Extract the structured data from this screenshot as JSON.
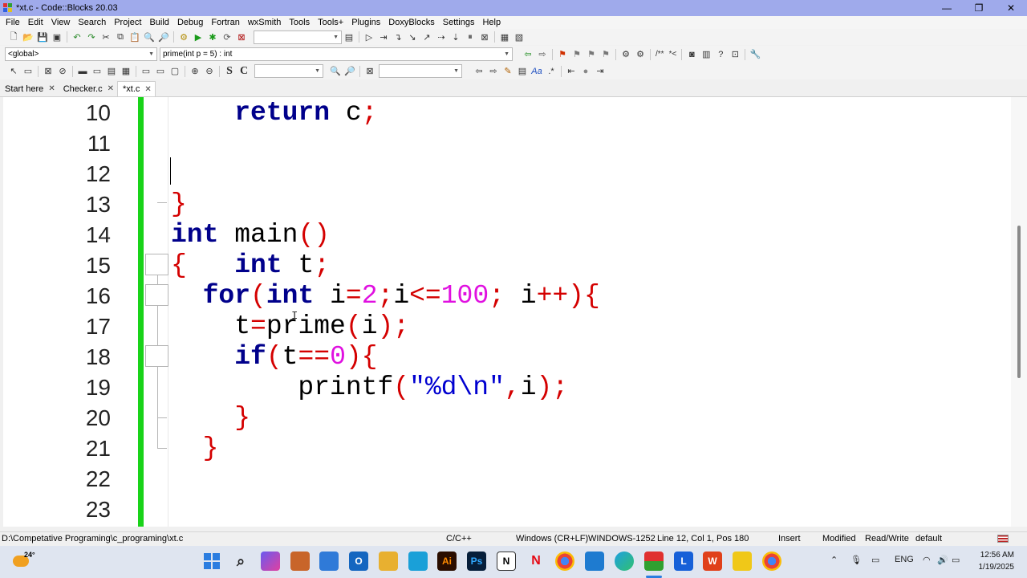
{
  "window": {
    "title": "*xt.c - Code::Blocks 20.03",
    "min": "—",
    "restore": "❐",
    "close": "✕"
  },
  "menu": [
    "File",
    "Edit",
    "View",
    "Search",
    "Project",
    "Build",
    "Debug",
    "Fortran",
    "wxSmith",
    "Tools",
    "Tools+",
    "Plugins",
    "DoxyBlocks",
    "Settings",
    "Help"
  ],
  "toolbar2": {
    "scope": "<global>",
    "symbol": "prime(int p = 5) : int"
  },
  "toolbar3": {
    "s_label": "S",
    "c_label": "C",
    "comment_label": "/**",
    "comment2_label": "*<"
  },
  "tabs": [
    {
      "label": "Start here",
      "active": false
    },
    {
      "label": "Checker.c",
      "active": false
    },
    {
      "label": "*xt.c",
      "active": true
    }
  ],
  "editor": {
    "lines": [
      {
        "num": "10",
        "tokens": [
          [
            "",
            "    "
          ],
          [
            "kw",
            "return"
          ],
          [
            "",
            " c"
          ],
          [
            "pu",
            ";"
          ]
        ]
      },
      {
        "num": "11",
        "tokens": []
      },
      {
        "num": "12",
        "tokens": []
      },
      {
        "num": "13",
        "tokens": [
          [
            "pu",
            "}"
          ]
        ]
      },
      {
        "num": "14",
        "tokens": [
          [
            "kw",
            "int"
          ],
          [
            "",
            " main"
          ],
          [
            "pu",
            "()"
          ]
        ]
      },
      {
        "num": "15",
        "tokens": [
          [
            "pu",
            "{"
          ],
          [
            "",
            "   "
          ],
          [
            "kw",
            "int"
          ],
          [
            "",
            " t"
          ],
          [
            "pu",
            ";"
          ]
        ]
      },
      {
        "num": "16",
        "tokens": [
          [
            "",
            "  "
          ],
          [
            "kw",
            "for"
          ],
          [
            "pu",
            "("
          ],
          [
            "kw",
            "int"
          ],
          [
            "",
            " i"
          ],
          [
            "pu",
            "="
          ],
          [
            "nm",
            "2"
          ],
          [
            "pu",
            ";"
          ],
          [
            "",
            "i"
          ],
          [
            "pu",
            "<="
          ],
          [
            "nm",
            "100"
          ],
          [
            "pu",
            ";"
          ],
          [
            "",
            " i"
          ],
          [
            "pu",
            "++){"
          ]
        ]
      },
      {
        "num": "17",
        "tokens": [
          [
            "",
            "    t"
          ],
          [
            "pu",
            "="
          ],
          [
            "",
            "prime"
          ],
          [
            "pu",
            "("
          ],
          [
            "",
            "i"
          ],
          [
            "pu",
            ");"
          ]
        ]
      },
      {
        "num": "18",
        "tokens": [
          [
            "",
            "    "
          ],
          [
            "kw",
            "if"
          ],
          [
            "pu",
            "("
          ],
          [
            "",
            "t"
          ],
          [
            "pu",
            "=="
          ],
          [
            "nm",
            "0"
          ],
          [
            "pu",
            "){"
          ]
        ]
      },
      {
        "num": "19",
        "tokens": [
          [
            "",
            "        printf"
          ],
          [
            "pu",
            "("
          ],
          [
            "st",
            "\"%d\\n\""
          ],
          [
            "pu",
            ","
          ],
          [
            "",
            "i"
          ],
          [
            "pu",
            ");"
          ]
        ]
      },
      {
        "num": "20",
        "tokens": [
          [
            "",
            "    "
          ],
          [
            "pu",
            "}"
          ]
        ]
      },
      {
        "num": "21",
        "tokens": [
          [
            "",
            "  "
          ],
          [
            "pu",
            "}"
          ]
        ]
      },
      {
        "num": "22",
        "tokens": []
      },
      {
        "num": "23",
        "tokens": []
      }
    ]
  },
  "status": {
    "path": "D:\\Competative Programing\\c_programing\\xt.c",
    "language": "C/C++",
    "eol": "Windows (CR+LF)",
    "encoding": "WINDOWS-1252",
    "position": "Line 12, Col 1, Pos 180",
    "mode": "Insert",
    "modified": "Modified",
    "access": "Read/Write",
    "profile": "default"
  },
  "taskbar": {
    "weather_temp": "24°",
    "language": "ENG",
    "time": "12:56 AM",
    "date": "1/19/2025"
  },
  "colors": {
    "titlebar": "#9faaeb",
    "changebar": "#19d319",
    "keyword": "#00008b",
    "punct": "#d40000",
    "number": "#e010e0",
    "string": "#0000d0"
  }
}
